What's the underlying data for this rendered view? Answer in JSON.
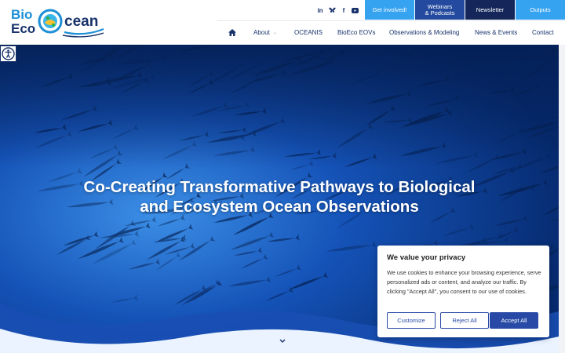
{
  "logo": {
    "line1": "Bio",
    "line2": "Eco",
    "suffix": "cean",
    "icon": "globe-fish-logo"
  },
  "social": [
    {
      "name": "linkedin",
      "glyph": "in"
    },
    {
      "name": "bluesky",
      "glyph": "❤"
    },
    {
      "name": "facebook",
      "glyph": "f"
    },
    {
      "name": "youtube",
      "glyph": "▶"
    }
  ],
  "topbar": {
    "get_involved": "Get involved!",
    "webinars_line1": "Webinars",
    "webinars_line2": "& Podcasts",
    "newsletter": "Newsletter",
    "outputs": "Outputs"
  },
  "nav": {
    "home_icon": "home-icon",
    "items": [
      "About",
      "OCEANIS",
      "BioEco EOVs",
      "Observations & Modeling",
      "News & Events",
      "Contact"
    ]
  },
  "hero": {
    "headline_line1": "Co-Creating Transformative Pathways to Biological",
    "headline_line2": "and Ecosystem Ocean Observations"
  },
  "cookie": {
    "title": "We value your privacy",
    "text": "We use cookies to enhance your browsing experience, serve personalized ads or content, and analyze our traffic. By clicking \"Accept All\", you consent to our use of cookies.",
    "customize": "Customize",
    "reject": "Reject All",
    "accept": "Accept All"
  },
  "colors": {
    "navy": "#17326b",
    "light_blue": "#36a3f0",
    "mid_blue": "#234a9e",
    "dark_navy": "#15275a",
    "cookie_button": "#284aa6"
  }
}
